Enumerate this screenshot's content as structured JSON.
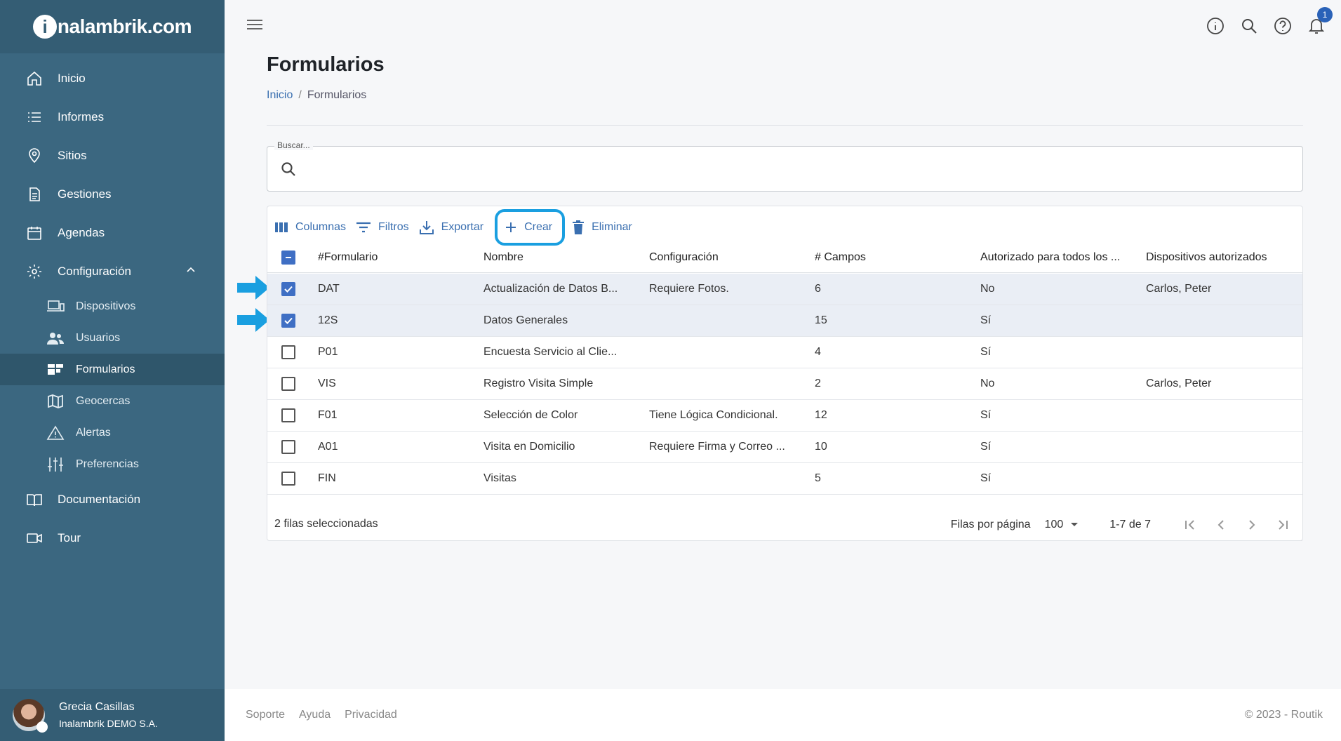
{
  "app": {
    "brand": "nalambrik.com",
    "brand_i": "i"
  },
  "sidebar": {
    "items": [
      {
        "label": "Inicio",
        "icon": "home-icon"
      },
      {
        "label": "Informes",
        "icon": "list-icon"
      },
      {
        "label": "Sitios",
        "icon": "location-pin-icon"
      },
      {
        "label": "Gestiones",
        "icon": "document-icon"
      },
      {
        "label": "Agendas",
        "icon": "calendar-icon"
      },
      {
        "label": "Configuración",
        "icon": "gear-icon"
      },
      {
        "label": "Documentación",
        "icon": "book-icon"
      },
      {
        "label": "Tour",
        "icon": "video-camera-icon"
      }
    ],
    "sub_items": [
      {
        "label": "Dispositivos",
        "icon": "devices-icon"
      },
      {
        "label": "Usuarios",
        "icon": "users-icon"
      },
      {
        "label": "Formularios",
        "icon": "forms-icon",
        "active": true
      },
      {
        "label": "Geocercas",
        "icon": "map-icon"
      },
      {
        "label": "Alertas",
        "icon": "warning-icon"
      },
      {
        "label": "Preferencias",
        "icon": "sliders-icon"
      }
    ]
  },
  "user": {
    "name": "Grecia Casillas",
    "org": "Inalambrik DEMO S.A."
  },
  "topbar": {
    "notification_count": "1"
  },
  "page": {
    "title": "Formularios"
  },
  "breadcrumb": {
    "home": "Inicio",
    "sep": "/",
    "current": "Formularios"
  },
  "search": {
    "label": "Buscar...",
    "value": ""
  },
  "toolbar": {
    "columns": "Columnas",
    "filters": "Filtros",
    "export": "Exportar",
    "create": "Crear",
    "delete": "Eliminar"
  },
  "table": {
    "headers": [
      "#Formulario",
      "Nombre",
      "Configuración",
      "# Campos",
      "Autorizado para todos los ...",
      "Dispositivos autorizados"
    ],
    "rows": [
      {
        "code": "DAT",
        "name": "Actualización de Datos B...",
        "config": "Requiere Fotos.",
        "campos": "6",
        "auth": "No",
        "disp": "Carlos, Peter",
        "selected": true
      },
      {
        "code": "12S",
        "name": "Datos Generales",
        "config": "",
        "campos": "15",
        "auth": "Sí",
        "disp": "",
        "selected": true
      },
      {
        "code": "P01",
        "name": "Encuesta Servicio al Clie...",
        "config": "",
        "campos": "4",
        "auth": "Sí",
        "disp": "",
        "selected": false
      },
      {
        "code": "VIS",
        "name": "Registro Visita Simple",
        "config": "",
        "campos": "2",
        "auth": "No",
        "disp": "Carlos, Peter",
        "selected": false
      },
      {
        "code": "F01",
        "name": "Selección de Color",
        "config": "Tiene Lógica Condicional.",
        "campos": "12",
        "auth": "Sí",
        "disp": "",
        "selected": false
      },
      {
        "code": "A01",
        "name": "Visita en Domicilio",
        "config": "Requiere Firma y Correo ...",
        "campos": "10",
        "auth": "Sí",
        "disp": "",
        "selected": false
      },
      {
        "code": "FIN",
        "name": "Visitas",
        "config": "",
        "campos": "5",
        "auth": "Sí",
        "disp": "",
        "selected": false
      }
    ]
  },
  "grid_footer": {
    "selected_count": "2 filas seleccionadas",
    "rows_per_page_label": "Filas por página",
    "rows_per_page": "100",
    "range": "1-7 de 7"
  },
  "footer": {
    "links": [
      "Soporte",
      "Ayuda",
      "Privacidad"
    ],
    "copyright": "© 2023 - Routik"
  },
  "colors": {
    "sidebar": "#3b6780",
    "accent": "#3a6fb0",
    "highlight": "#1a9fe0",
    "checkbox": "#3f6fc4"
  }
}
